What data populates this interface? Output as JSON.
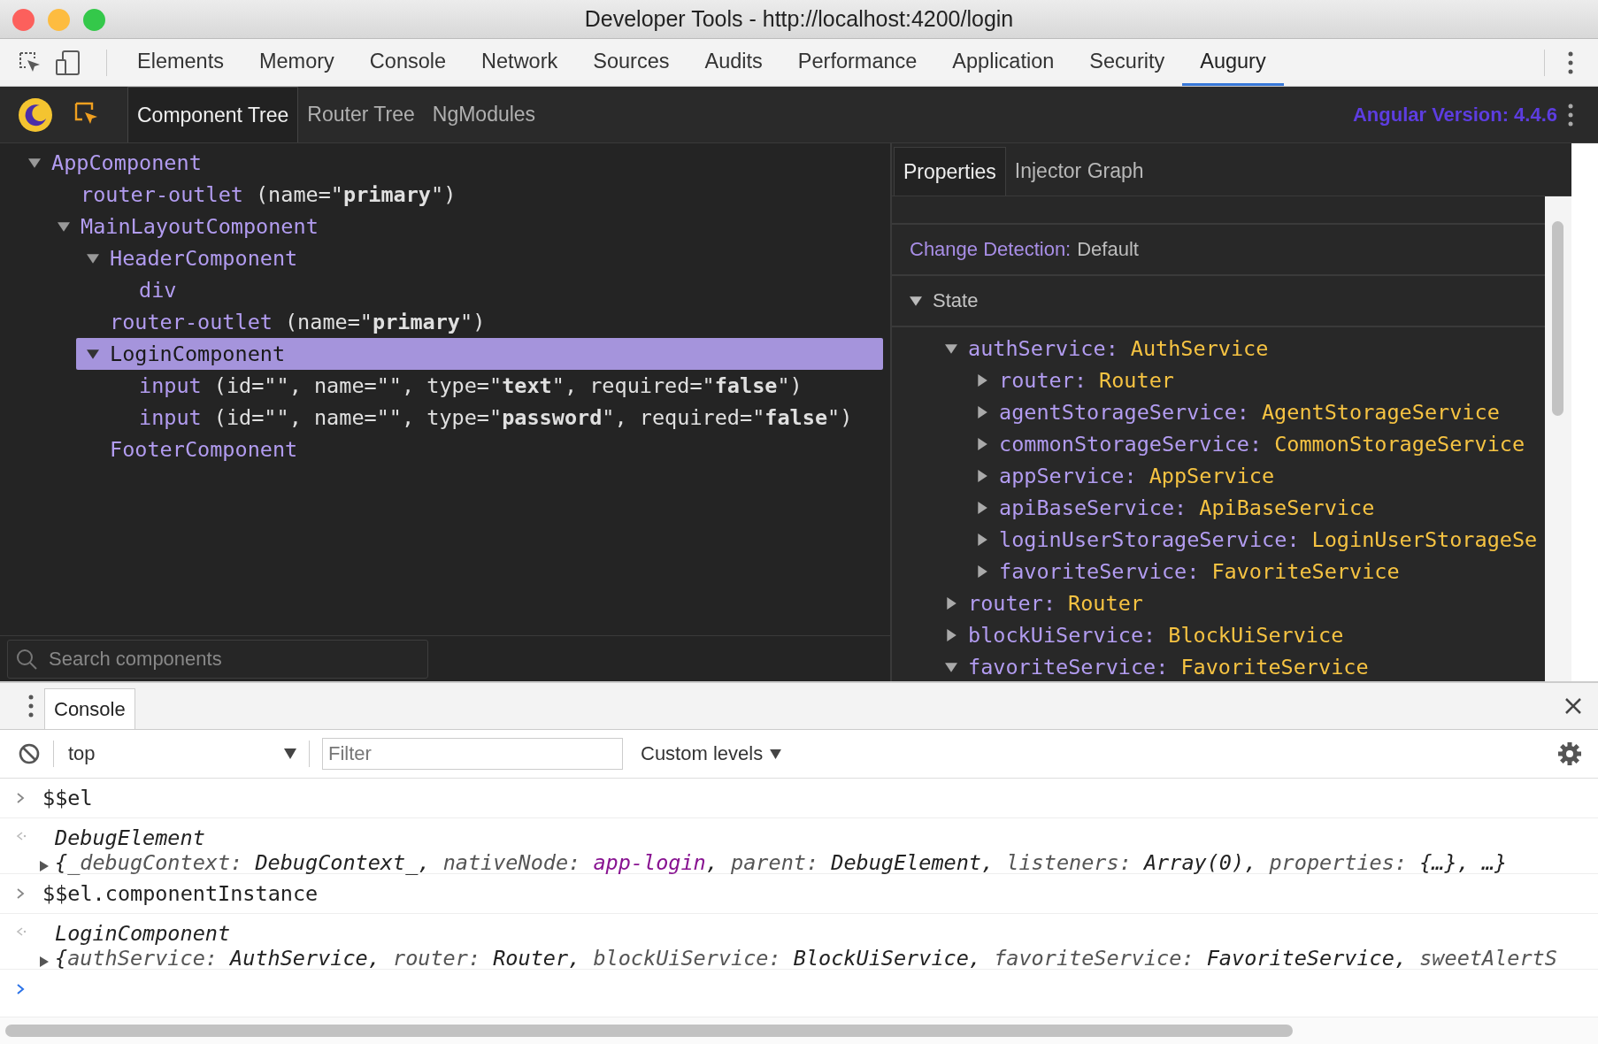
{
  "window": {
    "title": "Developer Tools - http://localhost:4200/login"
  },
  "devtools_tabs": [
    {
      "label": "Elements",
      "selected": false
    },
    {
      "label": "Memory",
      "selected": false
    },
    {
      "label": "Console",
      "selected": false
    },
    {
      "label": "Network",
      "selected": false
    },
    {
      "label": "Sources",
      "selected": false
    },
    {
      "label": "Audits",
      "selected": false
    },
    {
      "label": "Performance",
      "selected": false
    },
    {
      "label": "Application",
      "selected": false
    },
    {
      "label": "Security",
      "selected": false
    },
    {
      "label": "Augury",
      "selected": true
    }
  ],
  "augury": {
    "tabs": [
      {
        "label": "Component Tree",
        "selected": true
      },
      {
        "label": "Router Tree",
        "selected": false
      },
      {
        "label": "NgModules",
        "selected": false
      }
    ],
    "version": "Angular Version: 4.4.6"
  },
  "component_tree": [
    {
      "name": "AppComponent",
      "expanded": true,
      "selected": false,
      "children": [
        {
          "name": "router-outlet",
          "attributes": "(name=\"**primary**\")",
          "selected": false
        },
        {
          "name": "MainLayoutComponent",
          "expanded": true,
          "selected": false,
          "children": [
            {
              "name": "HeaderComponent",
              "expanded": true,
              "selected": false,
              "children": [
                {
                  "name": "div",
                  "selected": false
                }
              ]
            },
            {
              "name": "router-outlet",
              "attributes": "(name=\"**primary**\")",
              "selected": false
            },
            {
              "name": "LoginComponent",
              "expanded": true,
              "selected": true,
              "children": [
                {
                  "name": "input",
                  "attributes": "(id=\"\", name=\"\", type=\"**text**\", required=\"**false**\")",
                  "selected": false
                },
                {
                  "name": "input",
                  "attributes": "(id=\"\", name=\"\", type=\"**password**\", required=\"**false**\")",
                  "selected": false
                }
              ]
            },
            {
              "name": "FooterComponent",
              "selected": false
            }
          ]
        }
      ]
    }
  ],
  "search": {
    "placeholder": "Search components"
  },
  "properties": {
    "tabs": [
      {
        "label": "Properties",
        "selected": true
      },
      {
        "label": "Injector Graph",
        "selected": false
      }
    ],
    "change_detection": {
      "label": "Change Detection:",
      "value": "Default"
    },
    "state": {
      "label": "State",
      "expanded": true,
      "items": [
        {
          "key": "authService:",
          "value": "AuthService",
          "expanded": true,
          "children": [
            {
              "key": "router:",
              "value": "Router",
              "expanded": false
            },
            {
              "key": "agentStorageService:",
              "value": "AgentStorageService",
              "expanded": false
            },
            {
              "key": "commonStorageService:",
              "value": "CommonStorageService",
              "expanded": false
            },
            {
              "key": "appService:",
              "value": "AppService",
              "expanded": false
            },
            {
              "key": "apiBaseService:",
              "value": "ApiBaseService",
              "expanded": false
            },
            {
              "key": "loginUserStorageService:",
              "value": "LoginUserStorageSe",
              "expanded": false
            },
            {
              "key": "favoriteService:",
              "value": "FavoriteService",
              "expanded": false
            }
          ]
        },
        {
          "key": "router:",
          "value": "Router",
          "expanded": false
        },
        {
          "key": "blockUiService:",
          "value": "BlockUiService",
          "expanded": false
        },
        {
          "key": "favoriteService:",
          "value": "FavoriteService",
          "expanded": true
        }
      ]
    }
  },
  "console": {
    "tabs": [
      {
        "label": "Console",
        "selected": true
      }
    ],
    "context": "top",
    "filter": {
      "placeholder": "Filter"
    },
    "levels": "Custom levels",
    "entries": [
      {
        "kind": "input",
        "text": "$$el"
      },
      {
        "kind": "result",
        "title": "DebugElement",
        "expanded": false,
        "parts": [
          {
            "text": "{",
            "kind": "value"
          },
          {
            "text": "_debugContext: ",
            "kind": "key"
          },
          {
            "text": "DebugContext_, ",
            "kind": "value"
          },
          {
            "text": "nativeNode: ",
            "kind": "key"
          },
          {
            "text": "app-login",
            "kind": "node"
          },
          {
            "text": ", ",
            "kind": "value"
          },
          {
            "text": "parent: ",
            "kind": "key"
          },
          {
            "text": "DebugElement, ",
            "kind": "value"
          },
          {
            "text": "listeners: ",
            "kind": "key"
          },
          {
            "text": "Array(0), ",
            "kind": "value"
          },
          {
            "text": "properties: ",
            "kind": "key"
          },
          {
            "text": "{…}, …}",
            "kind": "value"
          }
        ]
      },
      {
        "kind": "input",
        "text": "$$el.componentInstance"
      },
      {
        "kind": "result",
        "title": "LoginComponent",
        "expanded": false,
        "parts": [
          {
            "text": "{",
            "kind": "value"
          },
          {
            "text": "authService: ",
            "kind": "key"
          },
          {
            "text": "AuthService, ",
            "kind": "value"
          },
          {
            "text": "router: ",
            "kind": "key"
          },
          {
            "text": "Router, ",
            "kind": "value"
          },
          {
            "text": "blockUiService: ",
            "kind": "key"
          },
          {
            "text": "BlockUiService, ",
            "kind": "value"
          },
          {
            "text": "favoriteService: ",
            "kind": "key"
          },
          {
            "text": "FavoriteService, ",
            "kind": "value"
          },
          {
            "text": "sweetAlertS",
            "kind": "key"
          }
        ]
      },
      {
        "kind": "prompt"
      }
    ]
  }
}
